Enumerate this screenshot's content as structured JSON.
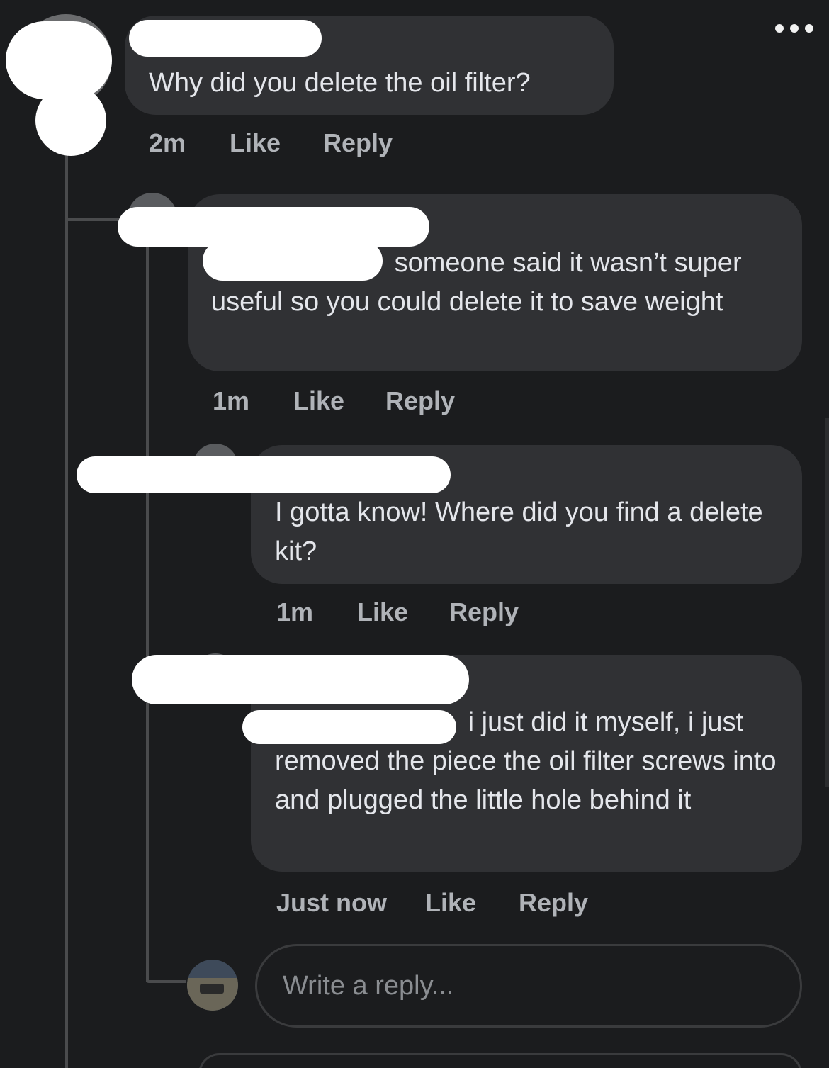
{
  "menu": {
    "icon": "more-horizontal-icon"
  },
  "comments": [
    {
      "author": "",
      "text": "Why did you delete the oil filter?",
      "time": "2m",
      "like_label": "Like",
      "reply_label": "Reply"
    },
    {
      "author": "",
      "text": "someone said it wasn’t super useful so you could delete it to save weight",
      "time": "1m",
      "like_label": "Like",
      "reply_label": "Reply"
    },
    {
      "author": "",
      "text": "I gotta know! Where did you find a delete kit?",
      "time": "1m",
      "like_label": "Like",
      "reply_label": "Reply"
    },
    {
      "author": "",
      "text": "i just did it myself, i just removed the piece the oil filter screws into and plugged the little hole behind it",
      "time": "Just now",
      "like_label": "Like",
      "reply_label": "Reply"
    }
  ],
  "reply_input": {
    "placeholder": "Write a reply..."
  }
}
